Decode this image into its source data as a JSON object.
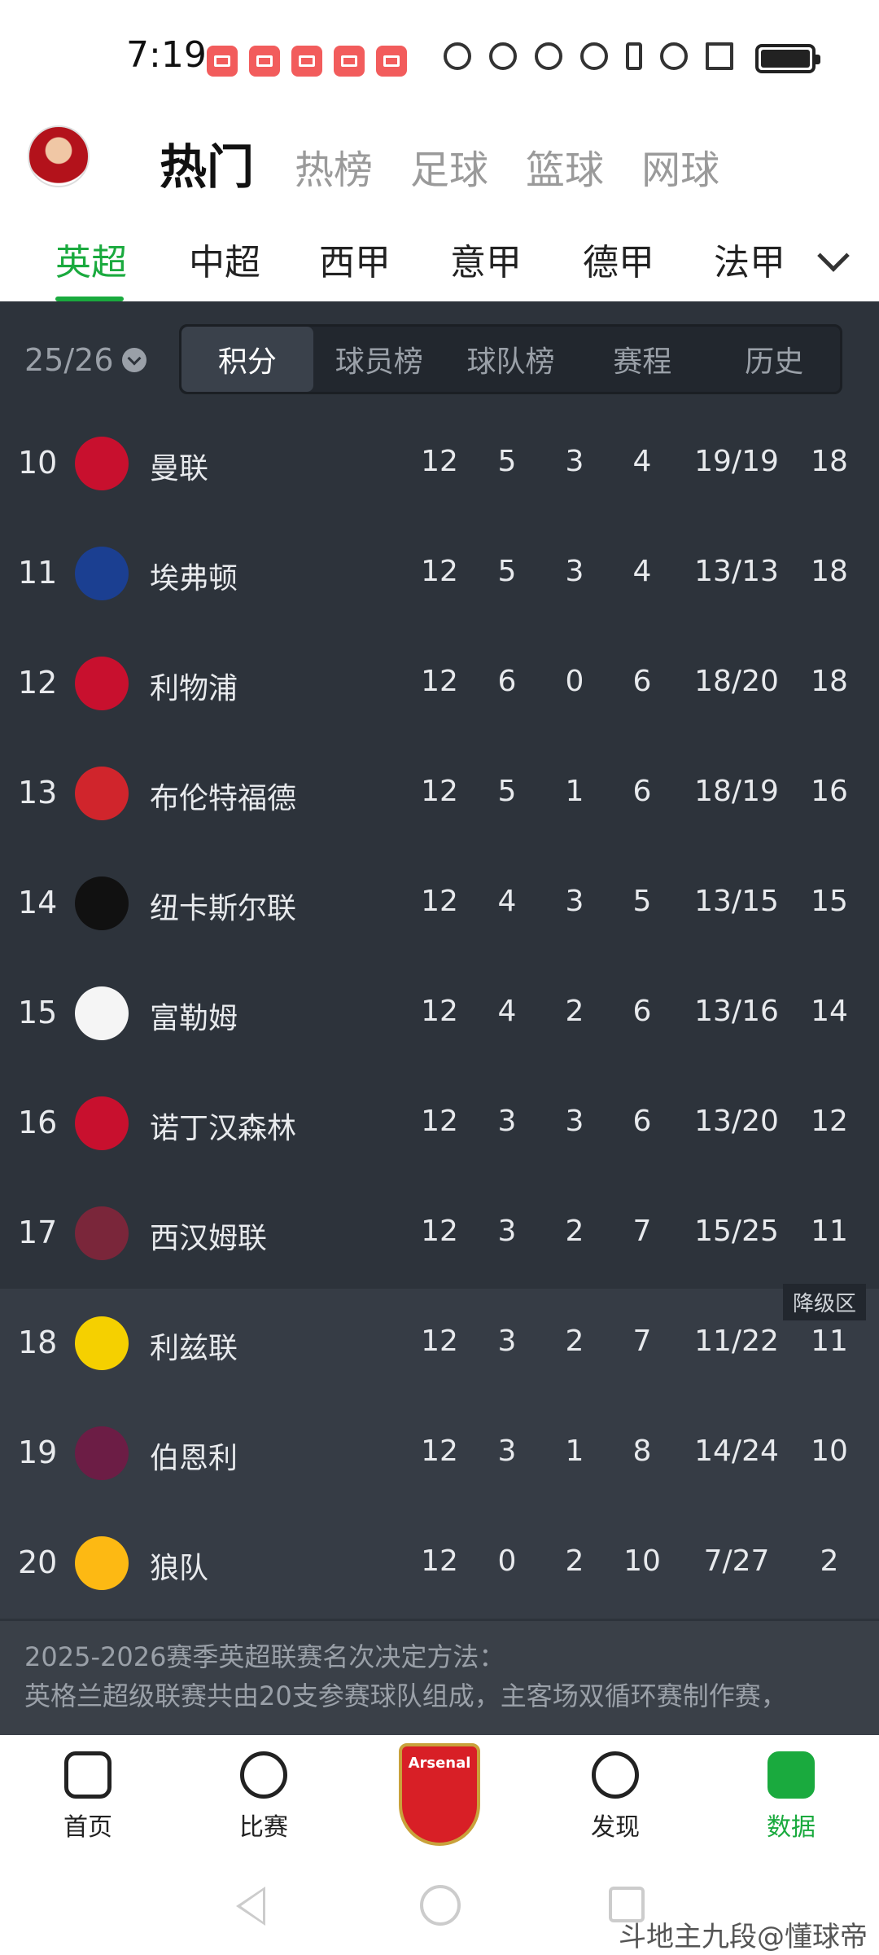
{
  "status": {
    "time": "7:19",
    "notification_icons": [
      "app-notif-icon",
      "app-notif-icon",
      "app-notif-icon",
      "app-notif-icon",
      "app-notif-icon"
    ],
    "system_icons": [
      "nfc-icon",
      "speed-icon",
      "eye-icon",
      "n-icon",
      "bluetooth-icon",
      "wifi-icon",
      "signal-icon",
      "battery-icon"
    ]
  },
  "header": {
    "tabs": [
      "热门",
      "热榜",
      "足球",
      "篮球",
      "网球"
    ],
    "active_tab": "热门"
  },
  "league_tabs": {
    "items": [
      "英超",
      "中超",
      "西甲",
      "意甲",
      "德甲",
      "法甲"
    ],
    "active": "英超"
  },
  "season": {
    "label": "25/26"
  },
  "segments": {
    "items": [
      "积分",
      "球员榜",
      "球队榜",
      "赛程",
      "历史"
    ],
    "active": "积分"
  },
  "relegation_label": "降级区",
  "table": {
    "rows": [
      {
        "rank": "10",
        "team": "曼联",
        "p": "12",
        "w": "5",
        "d": "3",
        "l": "4",
        "goals": "19/19",
        "pts": "18",
        "color": "#c8102e",
        "zone": "normal"
      },
      {
        "rank": "11",
        "team": "埃弗顿",
        "p": "12",
        "w": "5",
        "d": "3",
        "l": "4",
        "goals": "13/13",
        "pts": "18",
        "color": "#1b3f91",
        "zone": "normal"
      },
      {
        "rank": "12",
        "team": "利物浦",
        "p": "12",
        "w": "6",
        "d": "0",
        "l": "6",
        "goals": "18/20",
        "pts": "18",
        "color": "#c8102e",
        "zone": "normal"
      },
      {
        "rank": "13",
        "team": "布伦特福德",
        "p": "12",
        "w": "5",
        "d": "1",
        "l": "6",
        "goals": "18/19",
        "pts": "16",
        "color": "#d0252c",
        "zone": "normal"
      },
      {
        "rank": "14",
        "team": "纽卡斯尔联",
        "p": "12",
        "w": "4",
        "d": "3",
        "l": "5",
        "goals": "13/15",
        "pts": "15",
        "color": "#111111",
        "zone": "normal"
      },
      {
        "rank": "15",
        "team": "富勒姆",
        "p": "12",
        "w": "4",
        "d": "2",
        "l": "6",
        "goals": "13/16",
        "pts": "14",
        "color": "#f5f5f5",
        "zone": "normal"
      },
      {
        "rank": "16",
        "team": "诺丁汉森林",
        "p": "12",
        "w": "3",
        "d": "3",
        "l": "6",
        "goals": "13/20",
        "pts": "12",
        "color": "#c8102e",
        "zone": "normal"
      },
      {
        "rank": "17",
        "team": "西汉姆联",
        "p": "12",
        "w": "3",
        "d": "2",
        "l": "7",
        "goals": "15/25",
        "pts": "11",
        "color": "#7a263a",
        "zone": "normal"
      },
      {
        "rank": "18",
        "team": "利兹联",
        "p": "12",
        "w": "3",
        "d": "2",
        "l": "7",
        "goals": "11/22",
        "pts": "11",
        "color": "#f5d000",
        "zone": "relegation"
      },
      {
        "rank": "19",
        "team": "伯恩利",
        "p": "12",
        "w": "3",
        "d": "1",
        "l": "8",
        "goals": "14/24",
        "pts": "10",
        "color": "#6c1d45",
        "zone": "relegation"
      },
      {
        "rank": "20",
        "team": "狼队",
        "p": "12",
        "w": "0",
        "d": "2",
        "l": "10",
        "goals": "7/27",
        "pts": "2",
        "color": "#fdb913",
        "zone": "relegation"
      }
    ]
  },
  "rules": {
    "title": "2025-2026赛季英超联赛名次决定方法：",
    "body": "英格兰超级联赛共由20支参赛球队组成，主客场双循环赛制作赛，"
  },
  "bottom_nav": {
    "items": [
      {
        "label": "首页",
        "icon": "home-doc-icon"
      },
      {
        "label": "比赛",
        "icon": "trophy-icon"
      },
      {
        "label": "",
        "icon": "arsenal-crest-icon"
      },
      {
        "label": "发现",
        "icon": "planet-icon"
      },
      {
        "label": "数据",
        "icon": "bar-chart-icon"
      }
    ],
    "active": "数据"
  },
  "watermark": "斗地主九段@懂球帝",
  "colors": {
    "accent": "#1aaa3e",
    "dark_bg": "#2d333b"
  }
}
